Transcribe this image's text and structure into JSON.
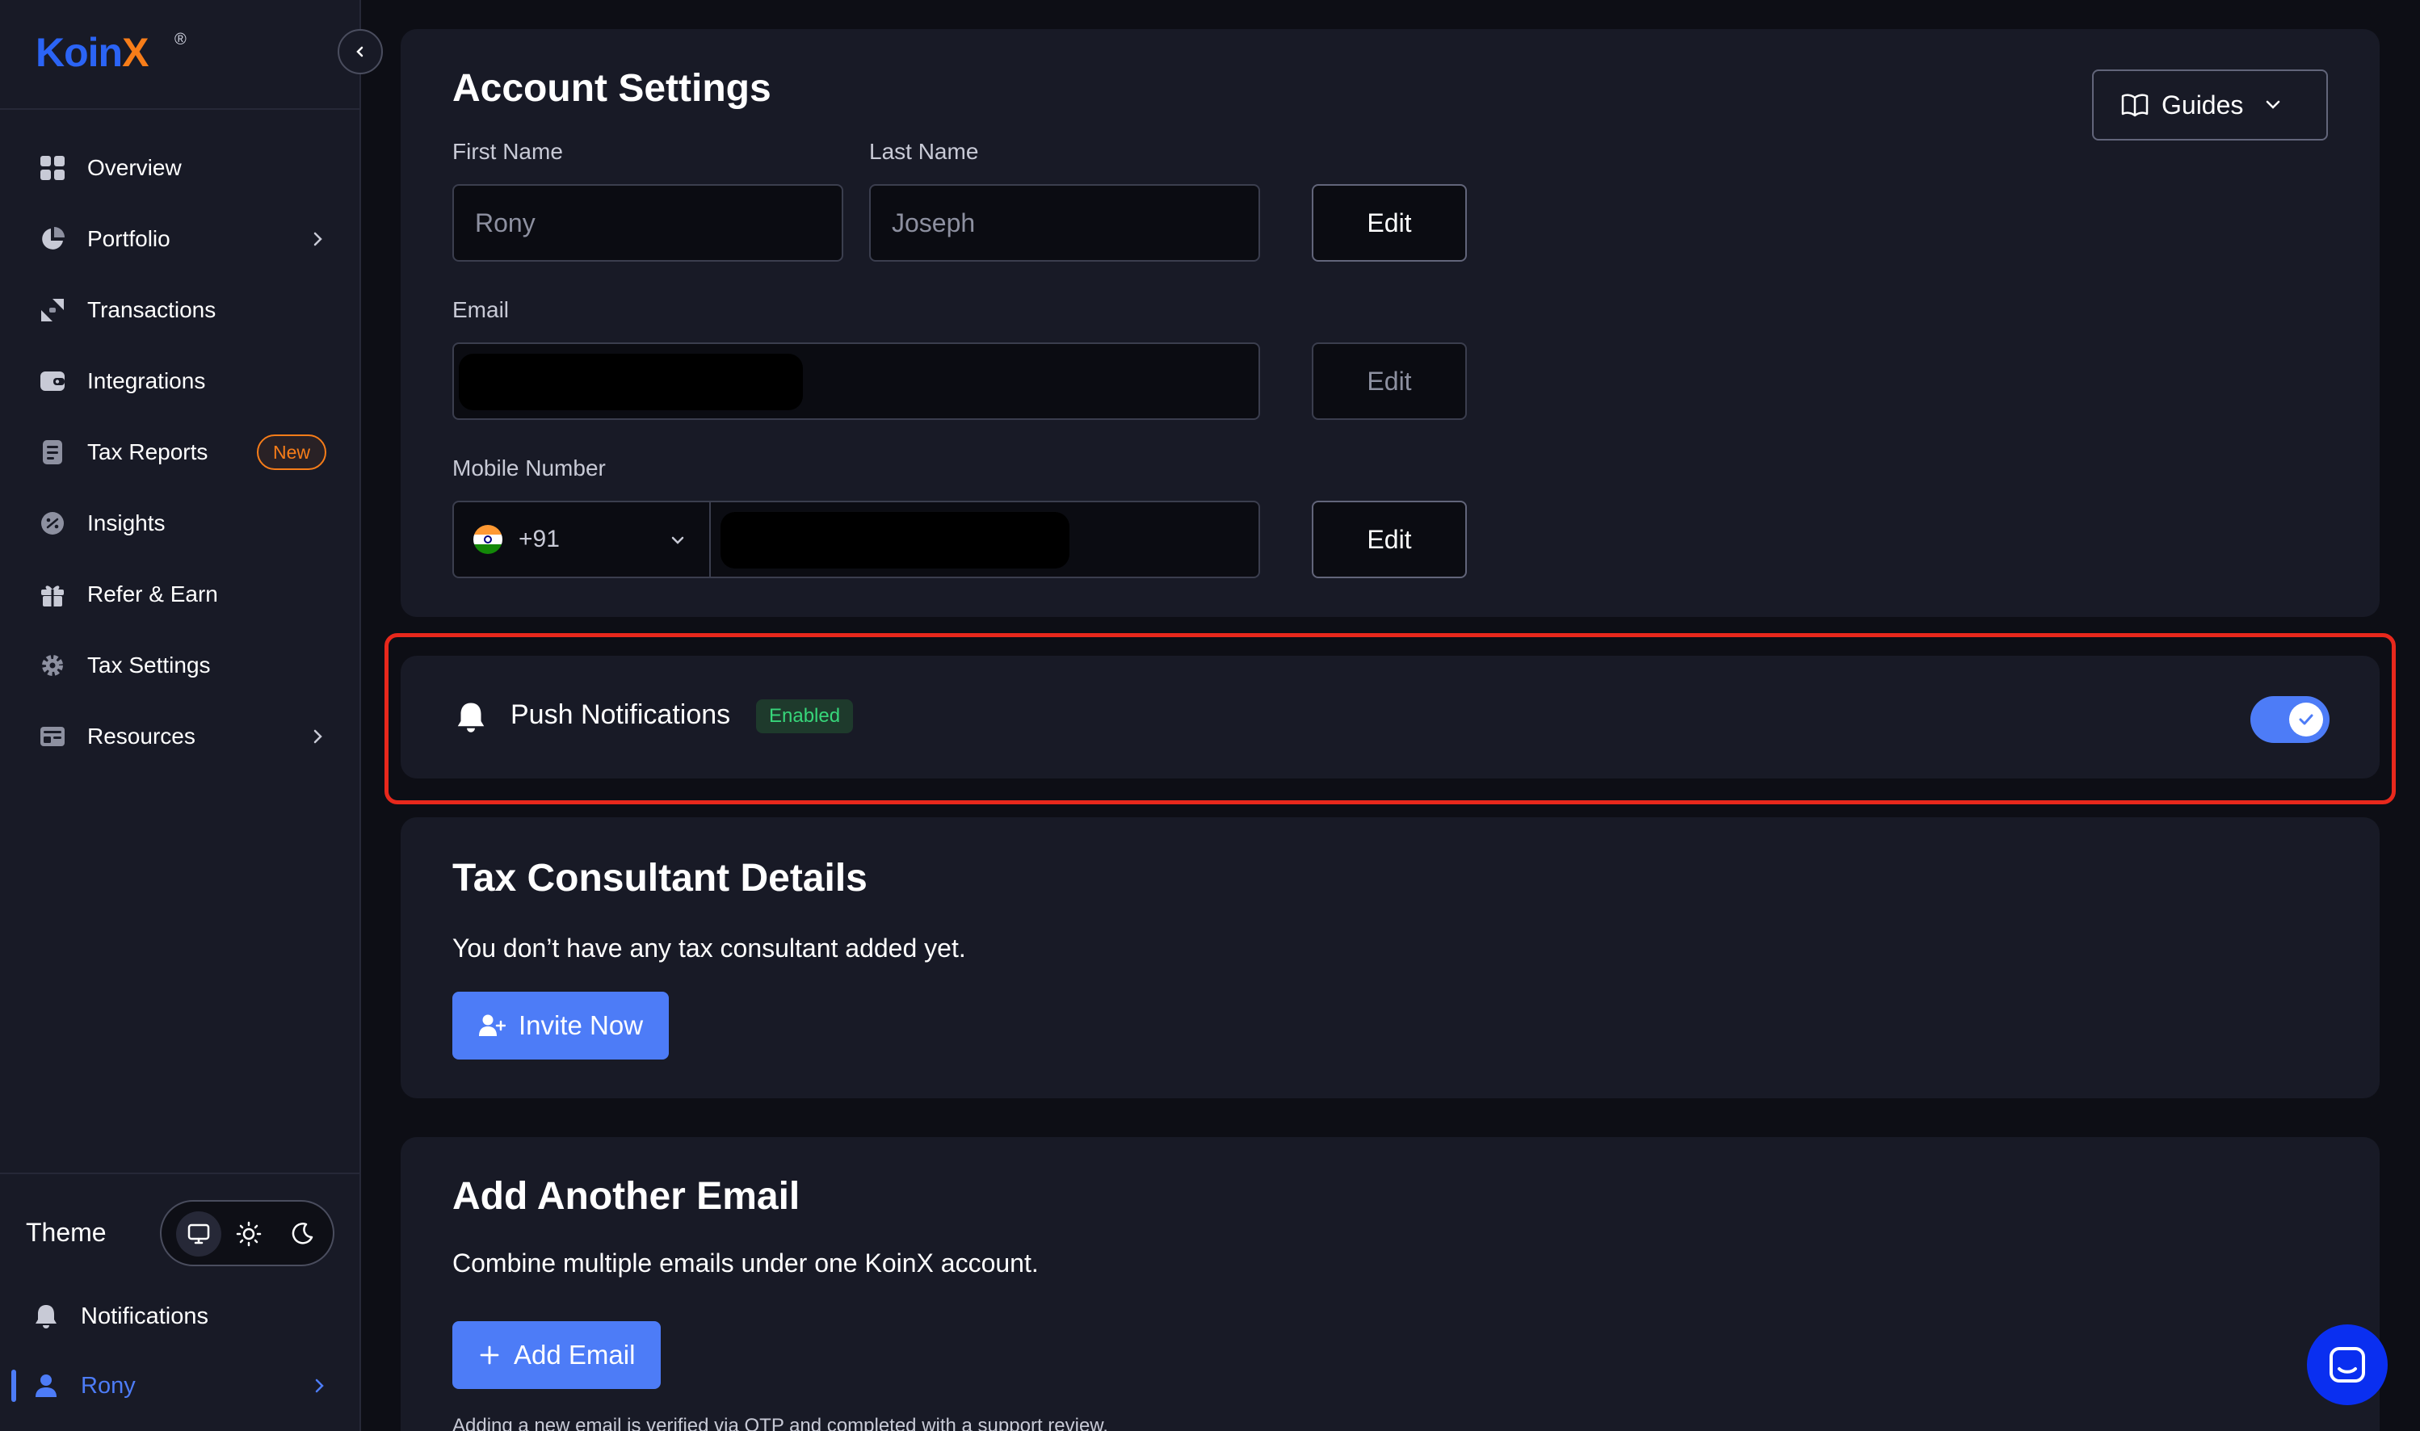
{
  "brand": {
    "name_main": "Koin",
    "name_accent": "X",
    "registered": "®"
  },
  "sidebar": {
    "items": [
      {
        "label": "Overview",
        "icon": "grid-icon"
      },
      {
        "label": "Portfolio",
        "icon": "pie-chart-icon"
      },
      {
        "label": "Transactions",
        "icon": "transfer-icon"
      },
      {
        "label": "Integrations",
        "icon": "wallet-icon"
      },
      {
        "label": "Tax Reports",
        "icon": "document-icon",
        "badge": "New"
      },
      {
        "label": "Insights",
        "icon": "insights-icon"
      },
      {
        "label": "Refer & Earn",
        "icon": "gift-icon"
      },
      {
        "label": "Tax Settings",
        "icon": "gear-icon"
      },
      {
        "label": "Resources",
        "icon": "resources-icon"
      }
    ],
    "theme_label": "Theme",
    "notifications_label": "Notifications",
    "user_label": "Rony"
  },
  "account": {
    "title": "Account Settings",
    "guides_label": "Guides",
    "first_name_label": "First Name",
    "first_name_value": "Rony",
    "last_name_label": "Last Name",
    "last_name_value": "Joseph",
    "email_label": "Email",
    "mobile_label": "Mobile Number",
    "country_code": "+91",
    "edit_label": "Edit"
  },
  "push": {
    "label": "Push Notifications",
    "status": "Enabled",
    "enabled": true
  },
  "tax_consultant": {
    "title": "Tax Consultant Details",
    "message": "You don’t have any tax consultant added yet.",
    "button": "Invite Now"
  },
  "add_email": {
    "title": "Add Another Email",
    "message": "Combine multiple emails under one KoinX account.",
    "button": "Add Email",
    "note": "Adding a new email is verified via OTP and completed with a support review."
  },
  "colors": {
    "accent": "#4d7cf7",
    "brand_blue": "#2b64f5",
    "brand_orange": "#f77d19",
    "highlight": "#e8281c",
    "success": "#37d67a"
  }
}
